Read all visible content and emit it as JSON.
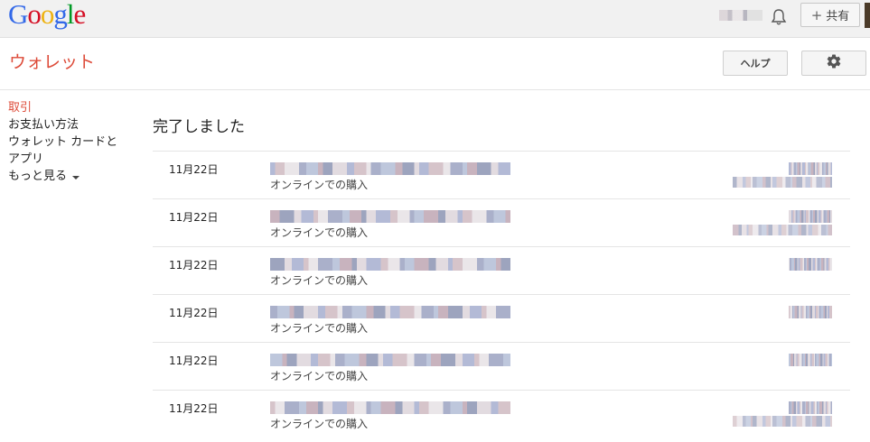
{
  "header": {
    "logo_letters": [
      {
        "char": "G",
        "color": "#3369e8"
      },
      {
        "char": "o",
        "color": "#d50f25"
      },
      {
        "char": "o",
        "color": "#eeb211"
      },
      {
        "char": "g",
        "color": "#3369e8"
      },
      {
        "char": "l",
        "color": "#009925"
      },
      {
        "char": "e",
        "color": "#d50f25"
      }
    ],
    "share_label": "共有"
  },
  "wallet": {
    "title": "ウォレット",
    "help_label": "ヘルプ"
  },
  "nav": {
    "items": [
      {
        "label": "取引",
        "active": true
      },
      {
        "label": "お支払い方法",
        "active": false
      },
      {
        "label": "ウォレット カードとアプリ",
        "active": false
      }
    ],
    "more_label": "もっと見る"
  },
  "main": {
    "section_title": "完了しました",
    "transactions": [
      {
        "date": "11月22日",
        "description": "オンラインでの購入"
      },
      {
        "date": "11月22日",
        "description": "オンラインでの購入"
      },
      {
        "date": "11月22日",
        "description": "オンラインでの購入"
      },
      {
        "date": "11月22日",
        "description": "オンラインでの購入"
      },
      {
        "date": "11月22日",
        "description": "オンラインでの購入"
      },
      {
        "date": "11月22日",
        "description": "オンラインでの購入"
      }
    ]
  },
  "colors": {
    "accent": "#dd4b39",
    "divider": "#e5e5e5",
    "topbar": "#f1f1f1"
  }
}
